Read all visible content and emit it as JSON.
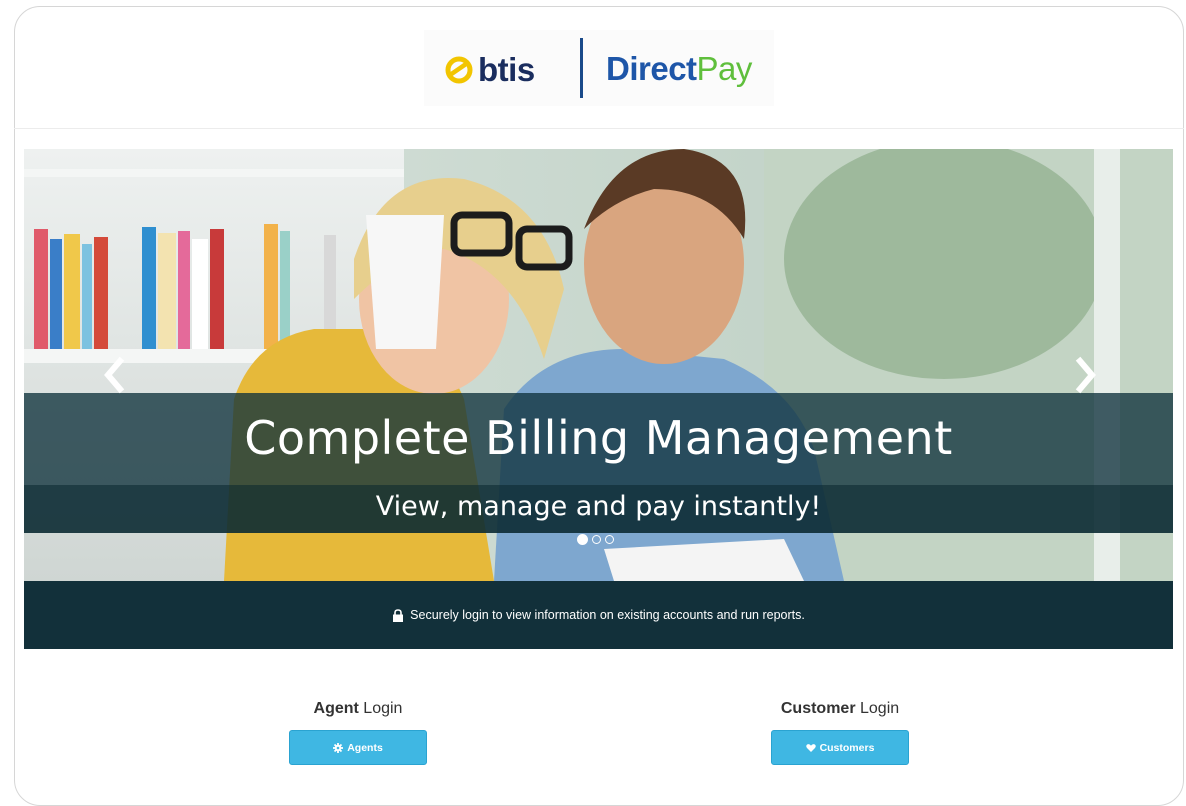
{
  "header": {
    "logo_left": "btis",
    "logo_right_a": "Direct",
    "logo_right_b": "Pay"
  },
  "carousel": {
    "title": "Complete Billing Management",
    "subtitle": "View, manage and pay instantly!",
    "prev_icon": "chevron-left-icon",
    "next_icon": "chevron-right-icon",
    "slide_count": 3,
    "active_slide": 1
  },
  "secure_bar": {
    "icon": "lock-icon",
    "text": "Securely login to view information on existing accounts and run reports."
  },
  "agent": {
    "title_bold": "Agent",
    "title_rest": " Login",
    "button_icon": "gear-icon",
    "button_label": "Agents"
  },
  "customer": {
    "title_bold": "Customer",
    "title_rest": " Login",
    "button_icon": "heart-icon",
    "button_label": "Customers"
  },
  "colors": {
    "accent_button": "#3fb7e3",
    "dark_band": "#12303a",
    "brand_navy": "#1a2d5e",
    "brand_blue": "#1e56a8",
    "brand_green": "#5fbf3c",
    "brand_yellow": "#f2c500"
  }
}
